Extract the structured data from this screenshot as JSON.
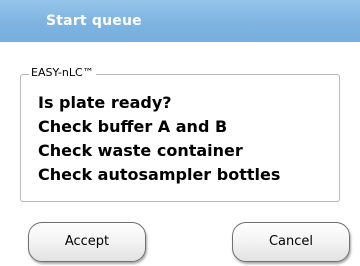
{
  "window": {
    "title": "Start queue"
  },
  "group": {
    "legend": "EASY-nLC™",
    "messages": [
      "Is plate ready?",
      "Check buffer A and B",
      "Check waste container",
      "Check autosampler bottles"
    ]
  },
  "buttons": {
    "accept_label": "Accept",
    "cancel_label": "Cancel"
  },
  "colors": {
    "titlebar": "#7fb4e1",
    "title_text": "#ffffff",
    "background": "#ffffff"
  }
}
